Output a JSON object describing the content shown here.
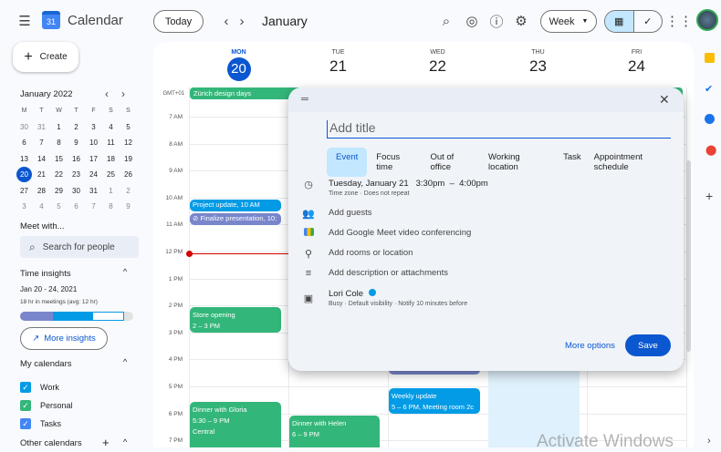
{
  "app": {
    "title": "Calendar",
    "logo_number": "31"
  },
  "header": {
    "today": "Today",
    "month": "January",
    "view": "Week"
  },
  "create": "Create",
  "mini": {
    "title": "January 2022",
    "weekdays": [
      "M",
      "T",
      "W",
      "T",
      "F",
      "S",
      "S"
    ],
    "weeks": [
      [
        "30",
        "31",
        "1",
        "2",
        "3",
        "4",
        "5"
      ],
      [
        "6",
        "7",
        "8",
        "9",
        "10",
        "11",
        "12"
      ],
      [
        "13",
        "14",
        "15",
        "16",
        "17",
        "18",
        "19"
      ],
      [
        "20",
        "21",
        "22",
        "23",
        "24",
        "25",
        "26"
      ],
      [
        "27",
        "28",
        "29",
        "30",
        "31",
        "1",
        "2"
      ],
      [
        "3",
        "4",
        "5",
        "6",
        "7",
        "8",
        "9"
      ]
    ],
    "today": "20"
  },
  "meet": {
    "title": "Meet with...",
    "placeholder": "Search for people"
  },
  "insights": {
    "title": "Time insights",
    "range": "Jan 20 - 24, 2021",
    "summary": "18 hr in meetings (avg: 12 hr)",
    "more": "More insights"
  },
  "my_calendars": {
    "title": "My calendars",
    "items": [
      {
        "label": "Work",
        "color": "#039be5"
      },
      {
        "label": "Personal",
        "color": "#33b679"
      },
      {
        "label": "Tasks",
        "color": "#4285f4"
      }
    ]
  },
  "other_calendars": {
    "title": "Other calendars"
  },
  "days": [
    {
      "dow": "MON",
      "num": "20"
    },
    {
      "dow": "TUE",
      "num": "21"
    },
    {
      "dow": "WED",
      "num": "22"
    },
    {
      "dow": "THU",
      "num": "23"
    },
    {
      "dow": "FRI",
      "num": "24"
    }
  ],
  "timezone": "GMT+01",
  "hours": [
    "7 AM",
    "8 AM",
    "9 AM",
    "10 AM",
    "11 AM",
    "12 PM",
    "1 PM",
    "2 PM",
    "3 PM",
    "4 PM",
    "5 PM",
    "6 PM",
    "7 PM"
  ],
  "events": {
    "allday": "Zürich design days",
    "project": "Project update, 10 AM",
    "finalize": "Finalize presentation, 10:",
    "store_t": "Store opening",
    "store_s": "2 – 3 PM",
    "gloria_t": "Dinner with Gloria",
    "gloria_s": "5:30 – 9 PM",
    "gloria_l": "Central",
    "helen_t": "Dinner with Helen",
    "helen_s": "6 – 9 PM",
    "weekly_t": "Weekly update",
    "weekly_s": "5 – 6 PM, Meeting room 2c"
  },
  "dialog": {
    "title_placeholder": "Add title",
    "tabs": [
      "Event",
      "Focus time",
      "Out of office",
      "Working location",
      "Task",
      "Appointment schedule"
    ],
    "date": "Tuesday, January 21",
    "start": "3:30pm",
    "dash": "–",
    "end": "4:00pm",
    "date_sub": "Time zone · Does not repeat",
    "guests": "Add guests",
    "meet": "Add Google Meet video conferencing",
    "location": "Add rooms or location",
    "description": "Add description or attachments",
    "owner": "Lori Cole",
    "owner_sub": "Busy · Default visibility · Notify 10 minutes before",
    "more": "More options",
    "save": "Save"
  },
  "watermark": "Activate Windows",
  "colors": {
    "accent": "#0b57d0",
    "green": "#33b679",
    "blue": "#039be5",
    "purple": "#7986cb",
    "now": "#d50000"
  }
}
